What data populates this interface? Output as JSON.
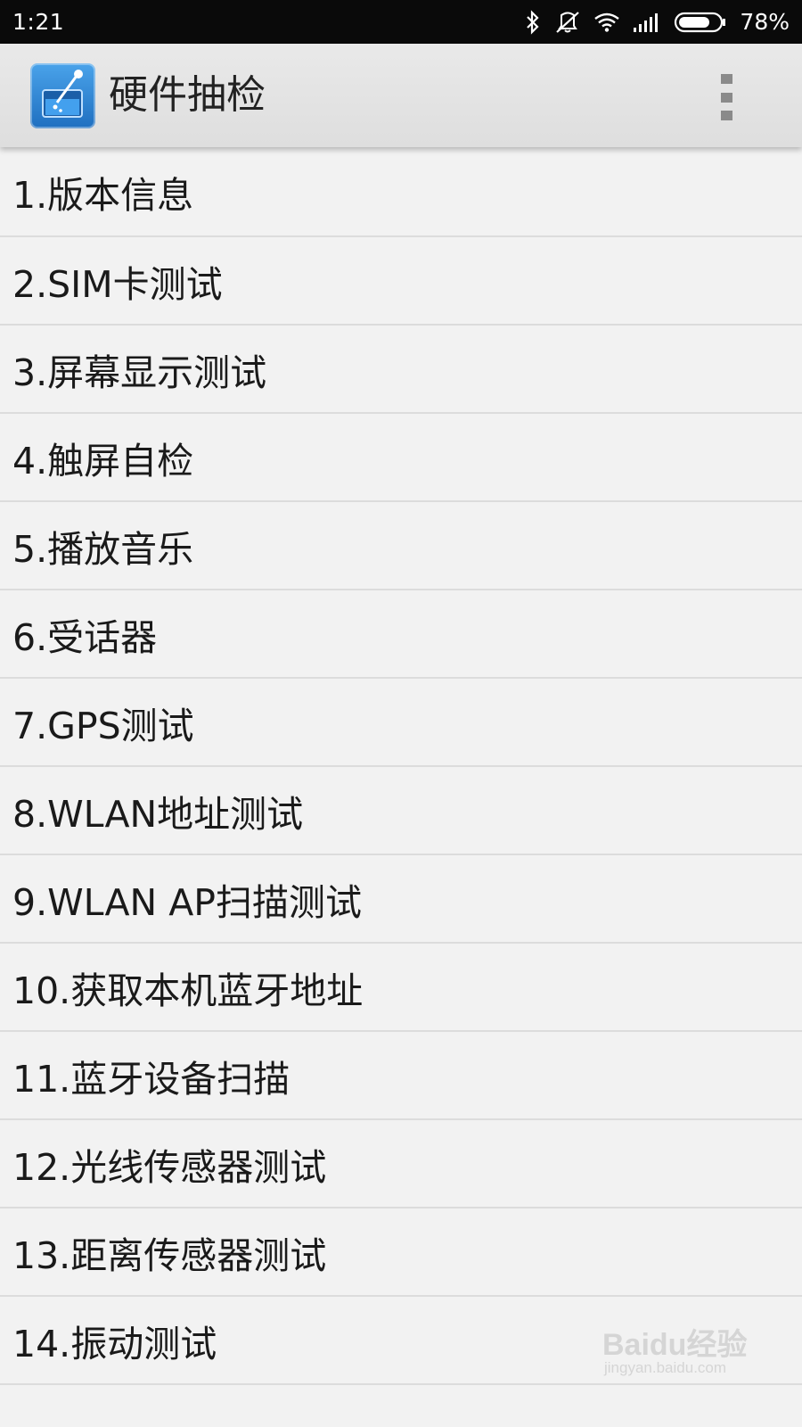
{
  "status_bar": {
    "time": "1:21",
    "battery_percent": "78%",
    "battery_level": 0.78,
    "icons": [
      "bluetooth-icon",
      "vibrate-icon",
      "wifi-icon",
      "signal-icon",
      "battery-icon"
    ]
  },
  "app_bar": {
    "title": "硬件抽检",
    "icon": "hardware-test-app-icon",
    "menu_icon": "overflow-menu-icon"
  },
  "menu_items": [
    "1.版本信息",
    "2.SIM卡测试",
    "3.屏幕显示测试",
    "4.触屏自检",
    "5.播放音乐",
    "6.受话器",
    "7.GPS测试",
    "8.WLAN地址测试",
    "9.WLAN AP扫描测试",
    "10.获取本机蓝牙地址",
    "11.蓝牙设备扫描",
    "12.光线传感器测试",
    "13.距离传感器测试",
    "14.振动测试"
  ],
  "watermark": {
    "brand": "Baidu经验",
    "url": "jingyan.baidu.com"
  },
  "colors": {
    "status_bar_bg": "#0a0a0a",
    "action_bar_bg": "#e4e4e4",
    "list_bg": "#f2f2f2",
    "divider": "#dcdcdc",
    "app_icon_blue": "#2f86d6"
  }
}
